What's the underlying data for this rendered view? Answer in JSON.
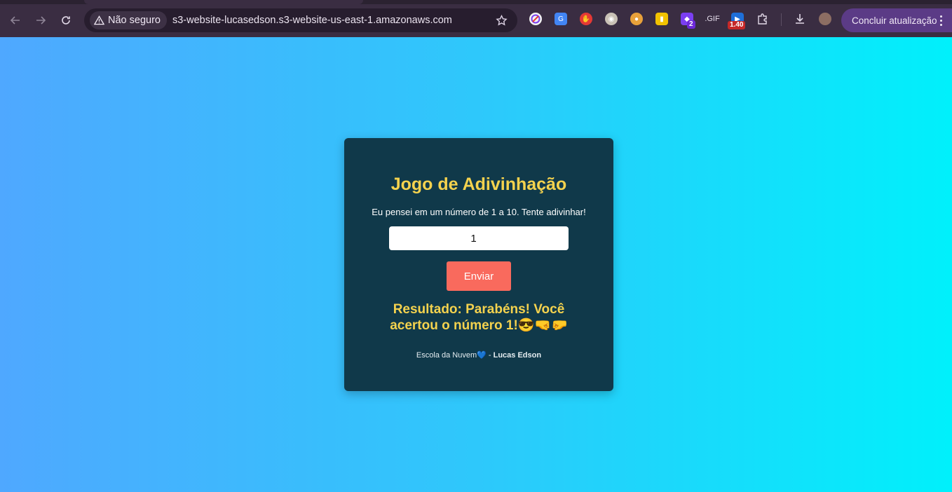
{
  "browser": {
    "security_label": "Não seguro",
    "url": "s3-website-lucasedson.s3-website-us-east-1.amazonaws.com",
    "update_label": "Concluir atualização",
    "extension_badges": {
      "ext7": "2",
      "ext9": "1.40"
    }
  },
  "game": {
    "title": "Jogo de Adivinhação",
    "subtitle": "Eu pensei em um número de 1 a 10. Tente adivinhar!",
    "input_value": "1",
    "button_label": "Enviar",
    "result_text": "Resultado: Parabéns! Você acertou o número 1!😎🤜🤛",
    "footer_text": "Escola da Nuvem💙 - ",
    "footer_author": "Lucas Edson"
  },
  "colors": {
    "page_gradient_start": "#4fa8ff",
    "page_gradient_end": "#00f0fb",
    "card_bg": "#10394a",
    "title": "#f4d24e",
    "button": "#f96a5d"
  }
}
